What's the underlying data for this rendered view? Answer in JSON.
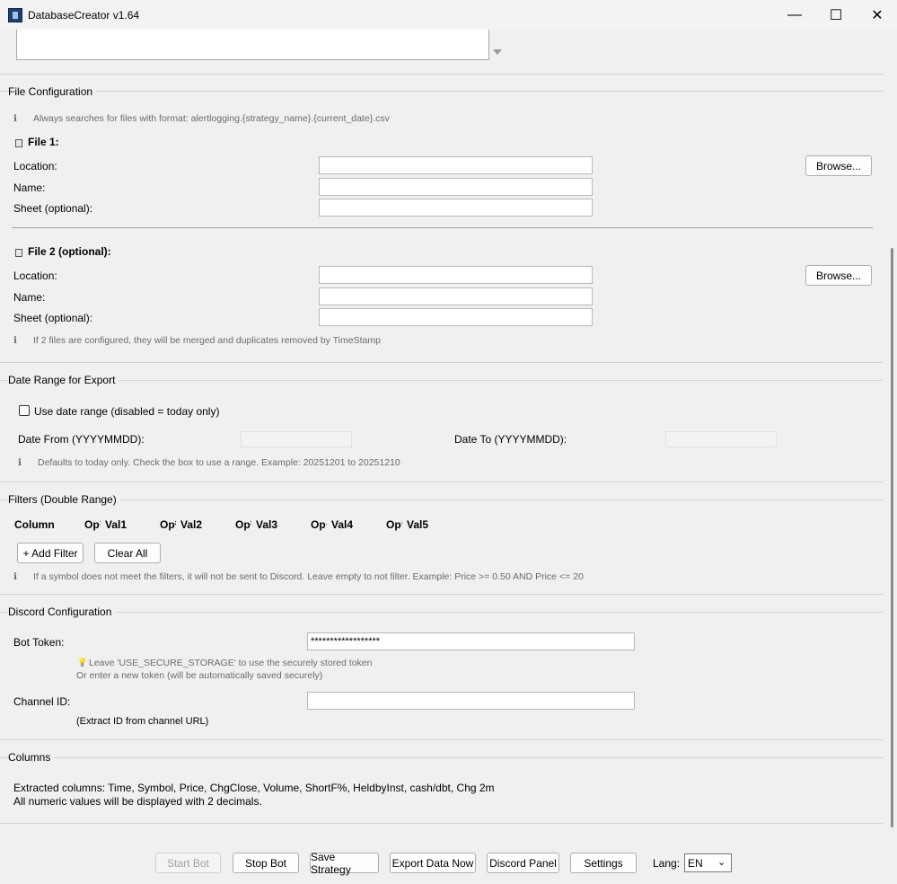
{
  "window": {
    "title": "DatabaseCreator v1.64",
    "minimize_glyph": "—",
    "maximize_glyph": "☐",
    "close_glyph": "✕"
  },
  "file_config": {
    "section_title": "File Configuration",
    "info_icon": "ℹ",
    "info": "Always searches for files with format: alertlogging.{strategy_name}.{current_date}.csv",
    "file1": {
      "title": "File 1:",
      "location_label": "Location:",
      "name_label": "Name:",
      "sheet_label": "Sheet (optional):",
      "location_value": "",
      "name_value": "",
      "sheet_value": "",
      "browse_label": "Browse..."
    },
    "file2": {
      "title": "File 2 (optional):",
      "location_label": "Location:",
      "name_label": "Name:",
      "sheet_label": "Sheet (optional):",
      "location_value": "",
      "name_value": "",
      "sheet_value": "",
      "browse_label": "Browse..."
    },
    "merge_info": "If 2 files are configured, they will be merged and duplicates removed by TimeStamp"
  },
  "date_range": {
    "section_title": "Date Range for Export",
    "checkbox_label": "Use date range (disabled = today only)",
    "checked": false,
    "date_from_label": "Date From (YYYYMMDD):",
    "date_to_label": "Date To (YYYYMMDD):",
    "date_from_value": "",
    "date_to_value": "",
    "info": "Defaults to today only. Check the box to use a range. Example: 20251201 to 20251210"
  },
  "filters": {
    "section_title": "Filters (Double Range)",
    "headers": [
      "Column",
      "Op¹",
      "Val1",
      "Op²",
      "Val2",
      "Op³",
      "Val3",
      "Op⁴",
      "Val4",
      "Op⁵",
      "Val5"
    ],
    "add_filter_label": "+ Add Filter",
    "clear_all_label": "Clear All",
    "info": "If a symbol does not meet the filters, it will not be sent to Discord. Leave empty to not filter. Example: Price >= 0.50 AND Price <= 20"
  },
  "discord": {
    "section_title": "Discord Configuration",
    "bot_token_label": "Bot Token:",
    "bot_token_value": "******************",
    "token_hint_icon": "💡",
    "token_hint_1": "Leave 'USE_SECURE_STORAGE' to use the securely stored token",
    "token_hint_2": "Or enter a new token (will be automatically saved securely)",
    "channel_id_label": "Channel ID:",
    "channel_id_value": "",
    "channel_hint": "(Extract ID from channel URL)"
  },
  "columns": {
    "section_title": "Columns",
    "line1": "Extracted columns: Time, Symbol, Price, ChgClose, Volume, ShortF%, HeldbyInst, cash/dbt, Chg 2m",
    "line2": "All numeric values will be displayed with 2 decimals."
  },
  "footer": {
    "start_bot": "Start Bot",
    "stop_bot": "Stop Bot",
    "save_strategy": "Save Strategy",
    "export_data": "Export Data Now",
    "discord_panel": "Discord Panel",
    "settings": "Settings",
    "lang_label": "Lang:",
    "lang_value": "EN"
  }
}
